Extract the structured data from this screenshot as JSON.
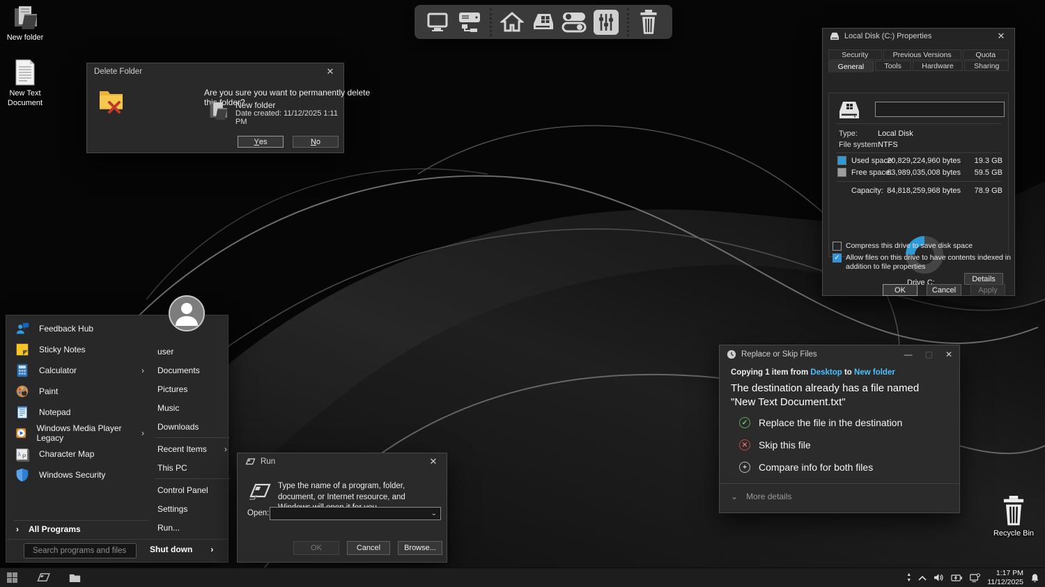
{
  "desktop": {
    "icon_new_folder": "New folder",
    "icon_new_text_document": "New Text Document",
    "icon_recycle_bin": "Recycle Bin"
  },
  "delete_dialog": {
    "title": "Delete Folder",
    "message": "Are you sure you want to permanently delete this folder?",
    "item_name": "New folder",
    "item_detail": "Date created: 11/12/2025 1:11 PM",
    "yes_accel": "Y",
    "yes_rest": "es",
    "no_accel": "N",
    "no_rest": "o"
  },
  "properties_dialog": {
    "title": "Local Disk (C:) Properties",
    "tabs_row1": [
      "Security",
      "Previous Versions",
      "Quota"
    ],
    "tabs_row2": [
      "General",
      "Tools",
      "Hardware",
      "Sharing"
    ],
    "active_tab": "General",
    "type_label": "Type:",
    "type_value": "Local Disk",
    "fs_label": "File system:",
    "fs_value": "NTFS",
    "used_label": "Used space:",
    "used_bytes": "20,829,224,960 bytes",
    "used_size": "19.3 GB",
    "free_label": "Free space:",
    "free_bytes": "63,989,035,008 bytes",
    "free_size": "59.5 GB",
    "capacity_label": "Capacity:",
    "capacity_bytes": "84,818,259,968 bytes",
    "capacity_size": "78.9 GB",
    "drive_label": "Drive C:",
    "details_button": "Details",
    "checkbox_compress": "Compress this drive to save disk space",
    "checkbox_index": "Allow files on this drive to have contents indexed in addition to file properties",
    "ok": "OK",
    "cancel": "Cancel",
    "apply": "Apply",
    "chart_data": {
      "type": "pie",
      "labels": [
        "Used space",
        "Free space"
      ],
      "values_gb": [
        19.3,
        59.5
      ],
      "values_bytes": [
        20829224960,
        63989035008
      ],
      "colors": [
        "#2e9bd6",
        "#454545"
      ],
      "center_label": "Drive C:"
    }
  },
  "start_menu": {
    "apps": [
      {
        "label": "Feedback Hub"
      },
      {
        "label": "Sticky Notes"
      },
      {
        "label": "Calculator",
        "submenu": true
      },
      {
        "label": "Paint"
      },
      {
        "label": "Notepad"
      },
      {
        "label": "Windows Media Player Legacy",
        "submenu": true
      },
      {
        "label": "Character Map"
      },
      {
        "label": "Windows Security"
      }
    ],
    "places": [
      "user",
      "Documents",
      "Pictures",
      "Music",
      "Downloads",
      "Recent Items",
      "This PC",
      "Control Panel",
      "Settings",
      "Run..."
    ],
    "all_programs": "All Programs",
    "search_placeholder": "Search programs and files",
    "shut_down": "Shut down"
  },
  "run_dialog": {
    "title": "Run",
    "message": "Type the name of a program, folder, document, or Internet resource, and Windows will open it for you.",
    "open_label": "Open:",
    "ok": "OK",
    "cancel": "Cancel",
    "browse": "Browse..."
  },
  "replace_dialog": {
    "title": "Replace or Skip Files",
    "copy_prefix": "Copying 1 item from",
    "copy_from_link": "Desktop",
    "copy_to_word": "to",
    "copy_to_link": "New folder",
    "heading": "The destination already has a file named \"New Text Document.txt\"",
    "option_replace": "Replace the file in the destination",
    "option_skip": "Skip this file",
    "option_compare": "Compare info for both files",
    "more_details": "More details"
  },
  "taskbar": {
    "time": "1:17 PM",
    "date": "11/12/2025"
  },
  "colors": {
    "accent_link": "#4cc2ff",
    "used_space": "#2e9bd6",
    "free_space_swatch": "#9d9d9d",
    "checkbox_accent": "#3793d6"
  }
}
